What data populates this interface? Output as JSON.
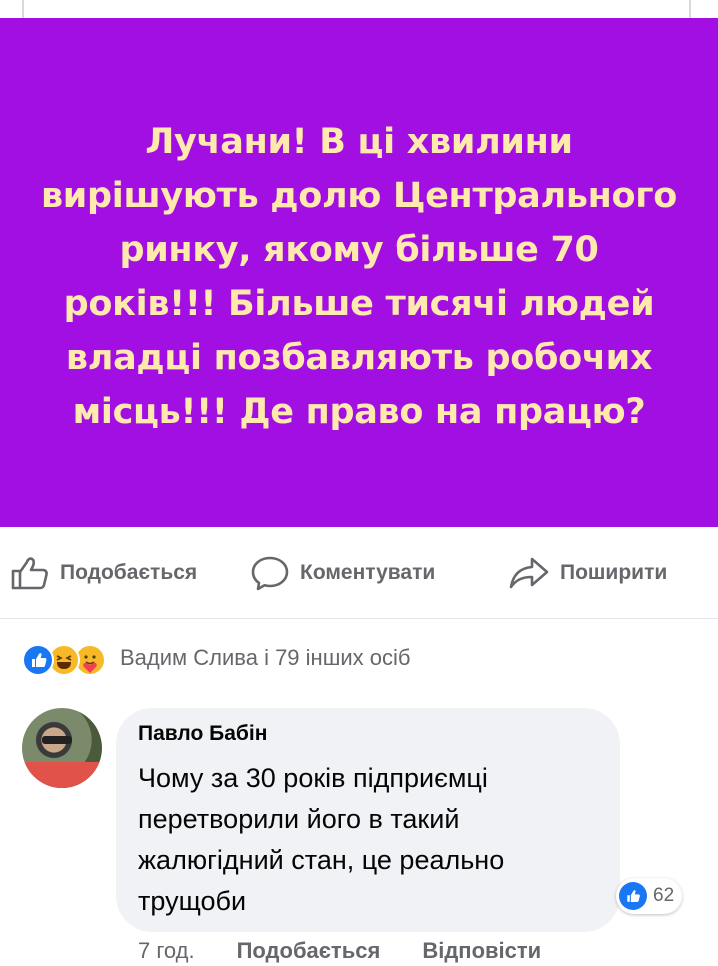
{
  "post": {
    "text": "Лучани! В ці хвилини вирішують долю Центрального ринку, якому більше 70 років!!! Більше тисячі людей владці позбавляють робочих місць!!! Де право на працю?",
    "background_color": "#a10fe3",
    "text_color": "#ffe9ac"
  },
  "actions": {
    "like_label": "Подобається",
    "like_icon": "thumbs-up-outline-icon",
    "comment_label": "Коментувати",
    "comment_icon": "speech-bubble-icon",
    "share_label": "Поширити",
    "share_icon": "share-arrow-icon"
  },
  "reactions": {
    "icons": [
      "like-reaction-icon",
      "haha-reaction-icon",
      "care-reaction-icon"
    ],
    "summary": "Вадим Слива і 79 інших осіб"
  },
  "comment": {
    "author": "Павло Бабін",
    "text": "Чому за 30 років підприємці перетворили його в такий жалюгідний стан,  це реально трущоби",
    "reaction_icon": "like-reaction-icon",
    "reaction_count": "62",
    "time": "7 год.",
    "like_label": "Подобається",
    "reply_label": "Відповісти"
  }
}
